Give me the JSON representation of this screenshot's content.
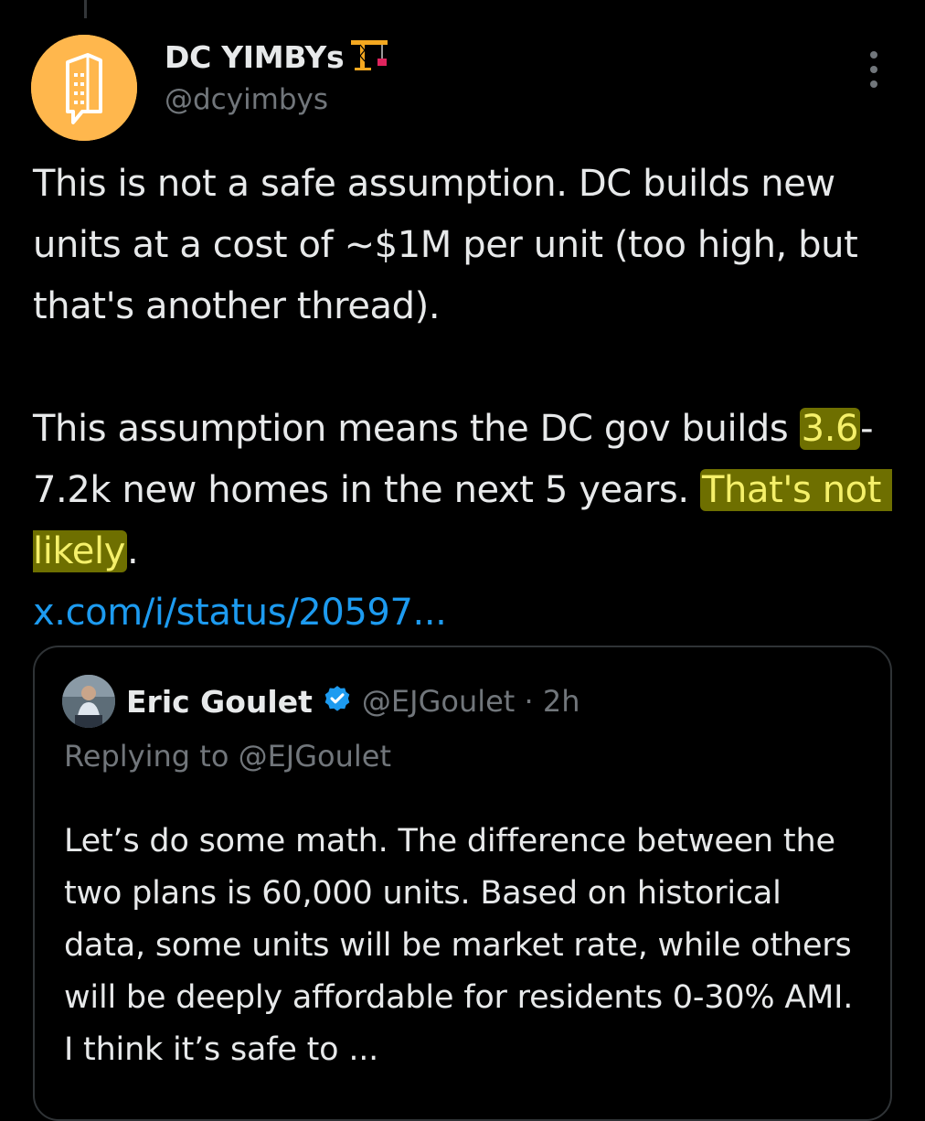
{
  "tweet": {
    "author": {
      "display_name": "DC YIMBYs",
      "name_emoji_icon": "construction-crane-icon",
      "handle": "@dcyimbys",
      "avatar_icon": "building-chat-bubble-icon",
      "avatar_color": "#ffb74d"
    },
    "more_icon": "vertical-ellipsis-icon",
    "text": {
      "p1": "This is not a safe assumption. DC builds new units at a cost of ~$1M per unit (too high, but that's another thread).",
      "p2_a": "This assumption means the DC gov builds ",
      "p2_hl1": "3.6",
      "p2_b": "-7.2k new homes in the next 5 years. ",
      "p2_hl2": "That's not likely",
      "p2_c": ".",
      "link": "x.com/i/status/20597..."
    },
    "highlight_color": "#6e6f00",
    "link_color": "#1d9bf0"
  },
  "quoted_tweet": {
    "display_name": "Eric Goulet",
    "verified_icon": "verified-badge-icon",
    "verified_color": "#1d9bf0",
    "handle_time": "@EJGoulet · 2h",
    "replying_to": "Replying to @EJGoulet",
    "text": "Let’s do some math. The difference between the two plans is 60,000 units. Based on historical data, some units will be market rate, while others will be deeply affordable for residents 0-30% AMI. I think it’s safe to ..."
  }
}
